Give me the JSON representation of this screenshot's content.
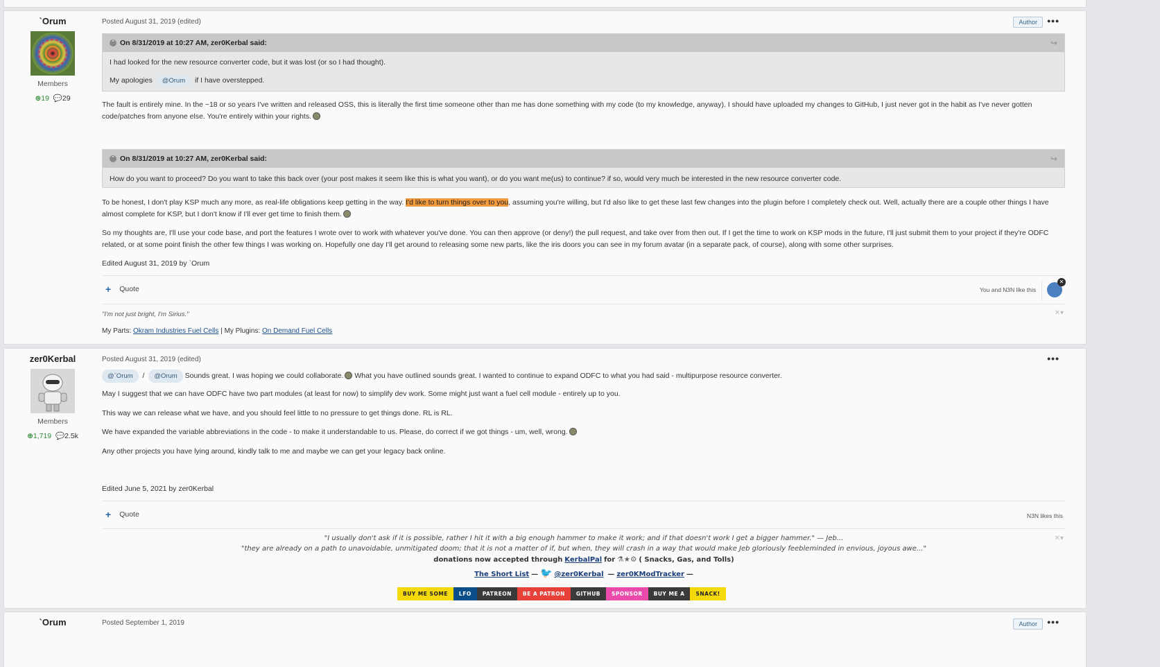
{
  "post1": {
    "author": "`Orum",
    "group": "Members",
    "rep": "19",
    "posts": "29",
    "posted": "Posted August 31, 2019 (edited)",
    "author_badge": "Author",
    "more": "•••",
    "quote1": {
      "header": "On 8/31/2019 at 10:27 AM, zer0Kerbal said:",
      "line1": "I had looked for the new resource converter code, but it was lost (or so I had thought).",
      "line2_prefix": "My apologies",
      "mention": "@Orum",
      "line2_suffix": "if I have overstepped."
    },
    "para1": "The fault is entirely mine.  In the ~18 or so years I've written and released OSS, this is literally the first time someone other than me has done something with my code (to my knowledge, anyway).  I should have uploaded my changes to GitHub, I just never got in the habit as I've never gotten code/patches from anyone else.  You're entirely within your rights.",
    "quote2": {
      "header": "On 8/31/2019 at 10:27 AM, zer0Kerbal said:",
      "line1": "How do you want to proceed? Do you want to take this back over (your post makes it seem like this is what you want), or do you want me(us) to continue? if so, would very much be interested in the new resource converter code."
    },
    "para2_a": "To be honest, I don't play KSP much any more, as real-life obligations keep getting in the way.",
    "para2_hl": "I'd like to turn things over to you",
    "para2_b": ", assuming you're willing, but I'd also like to get these last few changes into the plugin before I completely check out.  Well, actually there are a couple other things I have almost complete for KSP, but I don't know if I'll ever get time to finish them.",
    "para3": "So my thoughts are, I'll use your code base, and port the features I wrote over to work with whatever you've done.  You can then approve (or deny!) the pull request, and take over from then out.  If I get the time to work on KSP mods in the future, I'll just submit them to your project if they're ODFC related, or at some point finish the other few things I was working on.  Hopefully one day I'll get around to releasing some new parts, like the iris doors you can see in my forum avatar (in a separate pack, of course), along with some other surprises.",
    "edited": "Edited August 31, 2019 by `Orum",
    "quote_label": "Quote",
    "likers": "You and N3N like this",
    "sig_quote": "\"I'm not just bright, I'm Sirius.\"",
    "sig_parts_label": "My Parts:",
    "sig_parts_link": "Okram Industries Fuel Cells",
    "sig_sep": "|",
    "sig_plugins_label": "My Plugins:",
    "sig_plugins_link": "On Demand Fuel Cells"
  },
  "post2": {
    "author": "zer0Kerbal",
    "group": "Members",
    "rep": "1,719",
    "posts": "2.5k",
    "posted": "Posted August 31, 2019 (edited)",
    "more": "•••",
    "mention1": "@`Orum",
    "slash": "/",
    "mention2": "@Orum",
    "line1_a": "Sounds great. I was hoping we could collaborate.",
    "line1_b": "What you have outlined sounds great. I wanted to continue to expand ODFC to what you had said - multipurpose resource converter.",
    "line2": "May I suggest that we can have ODFC have two part modules (at least for now) to simplify dev work. Some might just want a fuel cell module - entirely up to you.",
    "line3": "This way we can release what we have, and you should feel little to no pressure to get things done. RL is RL.",
    "line4": "We have expanded the variable abbreviations in the code - to make it understandable to us. Please, do correct if we got things - um, well, wrong.",
    "line5": "Any other projects you have lying around, kindly talk to me and maybe we can get your legacy back online.",
    "edited": "Edited June 5, 2021 by zer0Kerbal",
    "quote_label": "Quote",
    "likers": "N3N likes this",
    "sig_line1": "\"I usually don't ask if it is possible, rather I hit it with a big enough hammer to make it work; and if that doesn't work I get a bigger hammer.\"  — Jeb...",
    "sig_line2": "\"they are already on a path to unavoidable, unmitigated doom; that it is not a matter of if, but when, they will crash in a way that would make Jeb gloriously feebleminded in envious, joyous awe...\"",
    "sig_line3_a": "donations now accepted through",
    "sig_line3_link": "KerbalPal",
    "sig_line3_b": "for",
    "sig_line3_c": "( Snacks, Gas, and Tolls)",
    "sig_line4_link1": "The Short List",
    "sig_line4_dash": "—",
    "sig_line4_link2": "@zer0Kerbal",
    "sig_line4_link3": "zer0KModTracker",
    "buttons": [
      {
        "label": "BUY ME SOME",
        "bg": "#f5d90a",
        "fg": "#222"
      },
      {
        "label": "LFO",
        "bg": "#0b4f8a",
        "fg": "#fff"
      },
      {
        "label": "PATREON",
        "bg": "#3a3a3a",
        "fg": "#fff"
      },
      {
        "label": "BE A PATRON",
        "bg": "#e8413a",
        "fg": "#fff"
      },
      {
        "label": "GITHUB",
        "bg": "#3a3a3a",
        "fg": "#fff"
      },
      {
        "label": "SPONSOR",
        "bg": "#ea4aaa",
        "fg": "#fff"
      },
      {
        "label": "BUY ME A",
        "bg": "#3a3a3a",
        "fg": "#fff"
      },
      {
        "label": "SNACK!",
        "bg": "#f5d90a",
        "fg": "#222"
      }
    ]
  },
  "post3": {
    "author": "`Orum",
    "posted": "Posted September 1, 2019",
    "author_badge": "Author",
    "more": "•••"
  }
}
